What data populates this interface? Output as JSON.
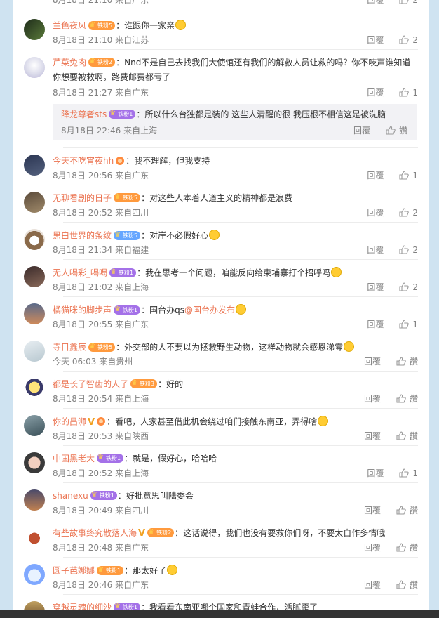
{
  "ui": {
    "reply_label": "回覆",
    "like_icon": "thumbs-up-outline-icon"
  },
  "top_partial": {
    "meta": "8月18日 21:10 来自广东",
    "likes": "2"
  },
  "comments": [
    {
      "user": "兰色夜风",
      "badge": "铁粉5",
      "text": "谁跟你一家亲",
      "meta": "8月18日 21:10 来自江苏",
      "likes": "2"
    },
    {
      "user": "芹菜兔肉",
      "badge": "铁粉2",
      "text": "Nnd不是自己去找我们大使馆还有我们的解救人员让救的吗？你不吱声谁知道你想要被救啊，路费邮费都亏了",
      "meta": "8月18日 21:27 来自广东",
      "likes": "1"
    },
    {
      "user": "今天不吃宵夜hh",
      "badge": "",
      "text": "我不理解，但我支持",
      "meta": "8月18日 20:56 来自广东",
      "likes": "1"
    },
    {
      "user": "无聊看剧的日子",
      "badge": "铁粉5",
      "text": "对这些人本着人道主义的精神都是浪费",
      "meta": "8月18日 20:52 来自四川",
      "likes": "2"
    },
    {
      "user": "黑白世界的条纹",
      "badge": "铁粉5",
      "text": "对岸不必假好心",
      "meta": "8月18日 21:34 来自福建",
      "likes": "2"
    },
    {
      "user": "无人喝彩_喝喝",
      "badge": "铁粉1",
      "text": "我在思考一个问题，咱能反向给柬埔寨打个招呼吗",
      "meta": "8月18日 21:02 来自上海",
      "likes": "2"
    },
    {
      "user": "橘猫咪的脚步声",
      "badge": "铁粉1",
      "text": "国台办qs",
      "mention": "@国台办发布",
      "meta": "8月18日 20:55 来自广东",
      "likes": "1"
    },
    {
      "user": "寺目鑫辰",
      "badge": "铁粉5",
      "text": "外交部的人不要以为拯救野生动物，这样动物就会感恩涕零",
      "meta": "今天 06:03 来自贵州",
      "likes": "讚"
    },
    {
      "user": "都是长了智齿的人了",
      "badge": "铁粉3",
      "text": "好的",
      "meta": "8月18日 20:54 来自上海",
      "likes": "讚"
    },
    {
      "user": "你的昌浉",
      "badge": "",
      "text": "看吧，人家甚至借此机会绕过咱们接触东南亚，弄得啥",
      "meta": "8月18日 20:53 来自陕西",
      "likes": "讚"
    },
    {
      "user": "中国黑老大",
      "badge": "铁粉1",
      "text": "就是，假好心，哈哈哈",
      "meta": "8月18日 20:52 来自上海",
      "likes": "1"
    },
    {
      "user": "shanexu",
      "badge": "铁粉1",
      "text": "好批意思叫陆委会",
      "meta": "8月18日 20:49 来自四川",
      "likes": "讚"
    },
    {
      "user": "有些故事终究散落人海",
      "badge": "铁粉2",
      "text": "这话说得，我们也没有要救你们呀，不要太自作多情哦",
      "meta": "8月18日 20:48 来自广东",
      "likes": "讚"
    },
    {
      "user": "圆子芭娜娜",
      "badge": "铁粉1",
      "text": "那太好了",
      "meta": "8月18日 20:46 来自广东",
      "likes": "讚"
    },
    {
      "user": "穿越灵魂的细沙",
      "badge": "铁粉1",
      "text": "我看看东南亚哪个国家和青蛙合作，活腻歪了",
      "meta": "",
      "likes": ""
    }
  ],
  "sub_reply": {
    "user": "降龙尊者sts",
    "badge": "铁粉1",
    "text": "所以什么台独都是装的 这些人清醒的很 我压根不相信这是被洗脑",
    "meta": "8月18日 22:46 来自上海",
    "likes": "讚"
  }
}
